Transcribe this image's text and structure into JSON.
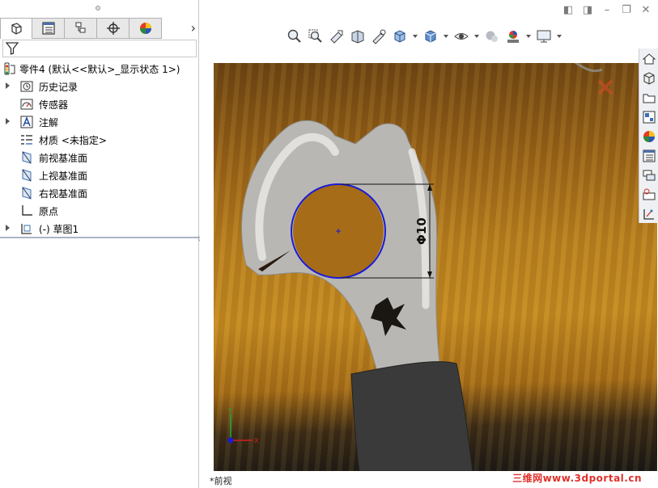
{
  "left_panel": {
    "tabs": [
      "feature-manager-tab",
      "property-manager-tab",
      "configuration-manager-tab",
      "dimxpert-manager-tab",
      "display-manager-tab"
    ],
    "tree": [
      {
        "label": "零件4  (默认<<默认>_显示状态 1>)",
        "icon": "part-icon",
        "level": "root",
        "expander": false
      },
      {
        "label": "历史记录",
        "icon": "history-folder-icon",
        "level": "child",
        "expander": true
      },
      {
        "label": "传感器",
        "icon": "sensor-icon",
        "level": "child",
        "expander": false
      },
      {
        "label": "注解",
        "icon": "annotation-icon",
        "level": "child",
        "expander": true
      },
      {
        "label": "材质 <未指定>",
        "icon": "material-icon",
        "level": "child",
        "expander": false
      },
      {
        "label": "前视基准面",
        "icon": "plane-icon",
        "level": "child",
        "expander": false
      },
      {
        "label": "上视基准面",
        "icon": "plane-icon",
        "level": "child",
        "expander": false
      },
      {
        "label": "右视基准面",
        "icon": "plane-icon",
        "level": "child",
        "expander": false
      },
      {
        "label": "原点",
        "icon": "origin-icon",
        "level": "child",
        "expander": false
      },
      {
        "label": "(-) 草图1",
        "icon": "sketch-icon",
        "level": "child",
        "expander": true
      }
    ]
  },
  "graphics": {
    "dimension_text": "Φ10",
    "view_name": "*前视",
    "watermark": "三维网www.3dportal.cn",
    "triad": {
      "x_label": "X",
      "y_label": "Y"
    },
    "sketch_color": "#1a1ad6"
  },
  "colors": {
    "wood_light": "#c48a20",
    "wood_dark": "#6b4312",
    "watermark": "#e0302a",
    "plane_icon": "#3b6fb6"
  }
}
